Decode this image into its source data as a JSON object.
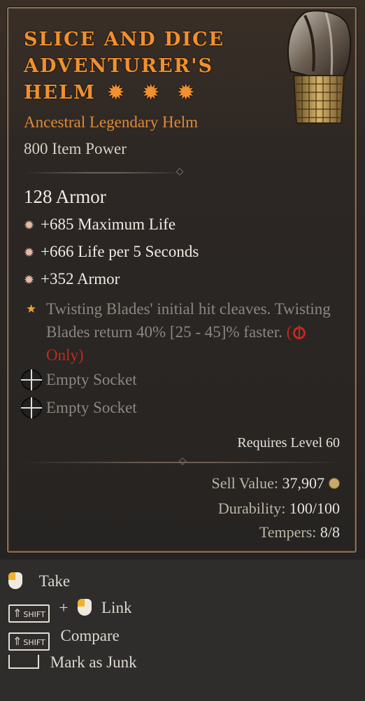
{
  "item": {
    "name": "Slice and Dice Adventurer's Helm",
    "name_lines": [
      "Slice and Dice",
      "Adventurer's",
      "Helm"
    ],
    "type": "Ancestral Legendary Helm",
    "power": "800 Item Power",
    "armor": "128 Armor",
    "affixes": [
      "+685 Maximum Life",
      "+666 Life per 5 Seconds",
      "+352 Armor"
    ],
    "aspect": {
      "text": "Twisting Blades' initial hit cleaves. Twisting Blades return 40% [25 - 45]% faster.",
      "restriction_open": "(",
      "restriction": "Only)"
    },
    "sockets": [
      "Empty Socket",
      "Empty Socket"
    ],
    "requirement": "Requires Level 60",
    "sell_label": "Sell Value:",
    "sell_value": "37,907",
    "durability_label": "Durability:",
    "durability_value": "100/100",
    "tempers_label": "Tempers:",
    "tempers_value": "8/8"
  },
  "controls": {
    "take": "Take",
    "link_plus": "+",
    "link": "Link",
    "compare": "Compare",
    "junk": "Mark as Junk",
    "shift_key": "SHIFT"
  },
  "colors": {
    "legendary": "#f0902e",
    "necro_red": "#c4281e",
    "aspect_gray": "#8b8780"
  },
  "icons": {
    "greater_affix": "sunburst-icon",
    "legendary_aspect": "star-icon",
    "socket": "crosshair-ring-icon",
    "gold": "gold-coin-icon",
    "mouse_left": "mouse-left-button-icon",
    "shift": "shift-key-icon",
    "spacebar": "spacebar-icon"
  }
}
